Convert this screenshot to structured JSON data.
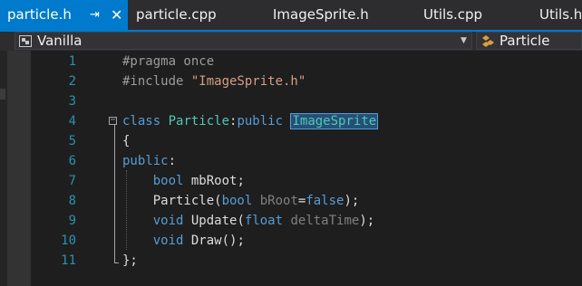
{
  "tabs": [
    {
      "label": "particle.h",
      "active": true,
      "pin_glyph": "⇥",
      "close_glyph": "✕"
    },
    {
      "label": "particle.cpp"
    },
    {
      "label": "ImageSprite.h"
    },
    {
      "label": "Utils.cpp"
    },
    {
      "label": "Utils.h"
    }
  ],
  "navbar": {
    "project": "Vanilla",
    "scope": "Particle",
    "project_icon": "project-icon",
    "scope_icon": "class-icon"
  },
  "editor": {
    "line_numbers": [
      "1",
      "2",
      "3",
      "4",
      "5",
      "6",
      "7",
      "8",
      "9",
      "10",
      "11"
    ],
    "code": {
      "l1": "#pragma once",
      "l2_directive": "#include ",
      "l2_string": "\"ImageSprite.h\"",
      "l4_class": "class",
      "l4_name": " Particle",
      "l4_colon": ":",
      "l4_public": "public",
      "l4_base": "ImageSprite",
      "l5": "{",
      "l6_public": "public",
      "l6_colon": ":",
      "l7_type": "bool",
      "l7_name": " mbRoot;",
      "l8_fn": "Particle(",
      "l8_type": "bool",
      "l8_param": " bRoot",
      "l8_eq": "=",
      "l8_false": "false",
      "l8_end": ");",
      "l9_void": "void",
      "l9_fn": " Update(",
      "l9_type": "float",
      "l9_param": " deltaTime",
      "l9_end": ");",
      "l10_void": "void",
      "l10_fn": " Draw();",
      "l11": "};"
    }
  },
  "colors": {
    "accent": "#007acc",
    "keyword": "#569cd6",
    "type": "#4ec9b0",
    "string": "#d69d85",
    "line_number": "#2b91af",
    "background": "#1e1e1e"
  }
}
